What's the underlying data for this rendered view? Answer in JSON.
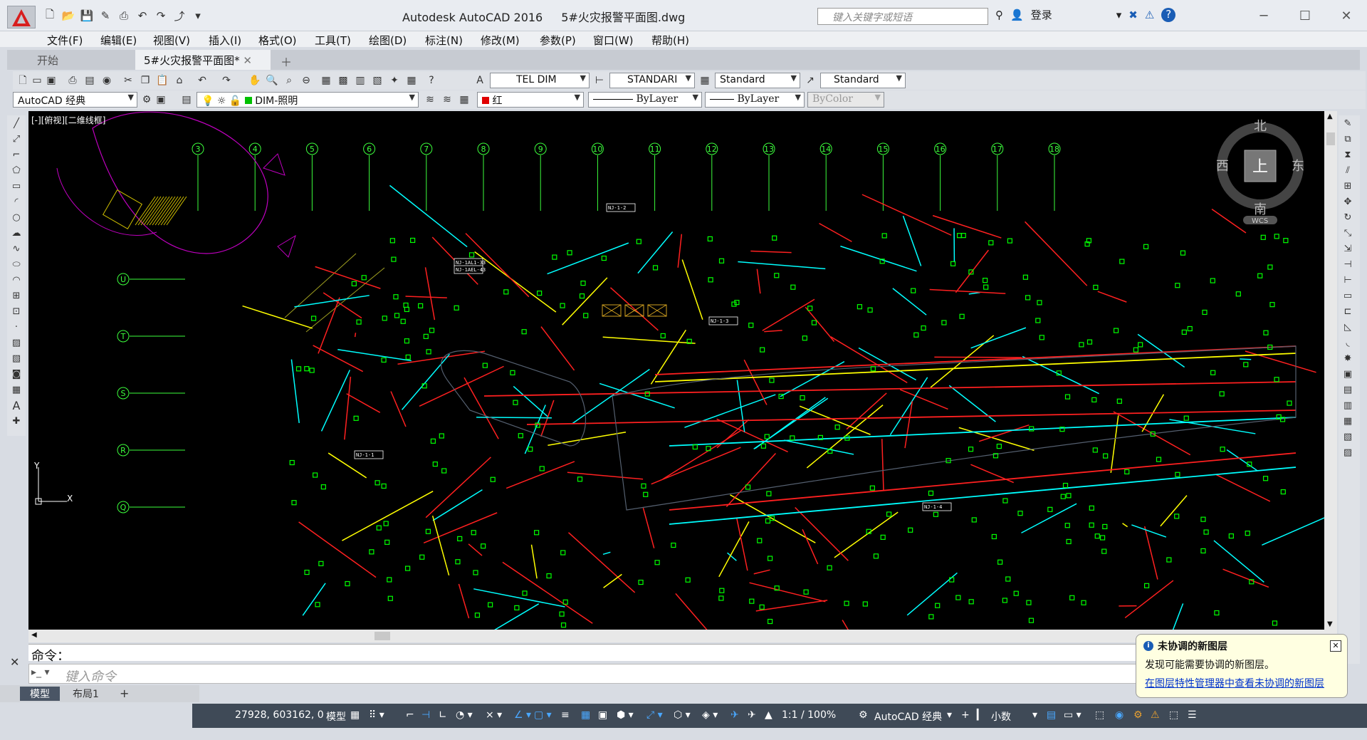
{
  "window": {
    "app_title": "Autodesk AutoCAD 2016",
    "file_title": "5#火灾报警平面图.dwg",
    "search_placeholder": "键入关键字或短语",
    "login_label": "登录"
  },
  "menu": [
    "文件(F)",
    "编辑(E)",
    "视图(V)",
    "插入(I)",
    "格式(O)",
    "工具(T)",
    "绘图(D)",
    "标注(N)",
    "修改(M)",
    "参数(P)",
    "窗口(W)",
    "帮助(H)"
  ],
  "file_tabs": {
    "start": "开始",
    "doc": "5#火灾报警平面图*"
  },
  "toolbar1": {
    "dimstyle": "TEL DIM",
    "textstyle": "STANDARI",
    "tablestyle": "Standard",
    "mleaderstyle": "Standard"
  },
  "toolbar2": {
    "workspace": "AutoCAD 经典",
    "layer": "DIM-照明",
    "color": "红",
    "linetype": "ByLayer",
    "lineweight": "ByLayer",
    "plotstyle": "ByColor"
  },
  "viewport_label": "[-][俯视][二维线框]",
  "viewcube": {
    "north": "北",
    "south": "南",
    "east": "东",
    "west": "西",
    "top": "上",
    "wcs": "WCS"
  },
  "grid_columns": [
    "3",
    "4",
    "5",
    "6",
    "7",
    "8",
    "9",
    "10",
    "11",
    "12",
    "13",
    "14",
    "15",
    "16",
    "17",
    "18"
  ],
  "grid_rows": [
    "U",
    "T",
    "S",
    "R",
    "Q"
  ],
  "drawing_labels": {
    "nj1": "NJ-1-2",
    "nj2": "NJ-1AL1-33",
    "nj3": "NJ-1AEL-43",
    "nj4": "NJ-1-3",
    "nj5": "NJ-1-1",
    "nj6": "NJ-1-4"
  },
  "ucs": {
    "x": "X",
    "y": "Y"
  },
  "command": {
    "history": "命令：",
    "placeholder": "键入命令"
  },
  "layout_tabs": {
    "model": "模型",
    "layout1": "布局1",
    "add": "+"
  },
  "status": {
    "coords": "27928, 603162, 0",
    "model": "模型",
    "scale": "1:1 / 100%",
    "workspace": "AutoCAD 经典",
    "units": "小数"
  },
  "notification": {
    "title": "未协调的新图层",
    "body": "发现可能需要协调的新图层。",
    "link": "在图层特性管理器中查看未协调的新图层"
  },
  "colors": {
    "canvas": "#000000",
    "red": "#ff2020",
    "cyan": "#00ffff",
    "green": "#00ff00",
    "yellow": "#ffff00",
    "magenta": "#c000c0"
  }
}
